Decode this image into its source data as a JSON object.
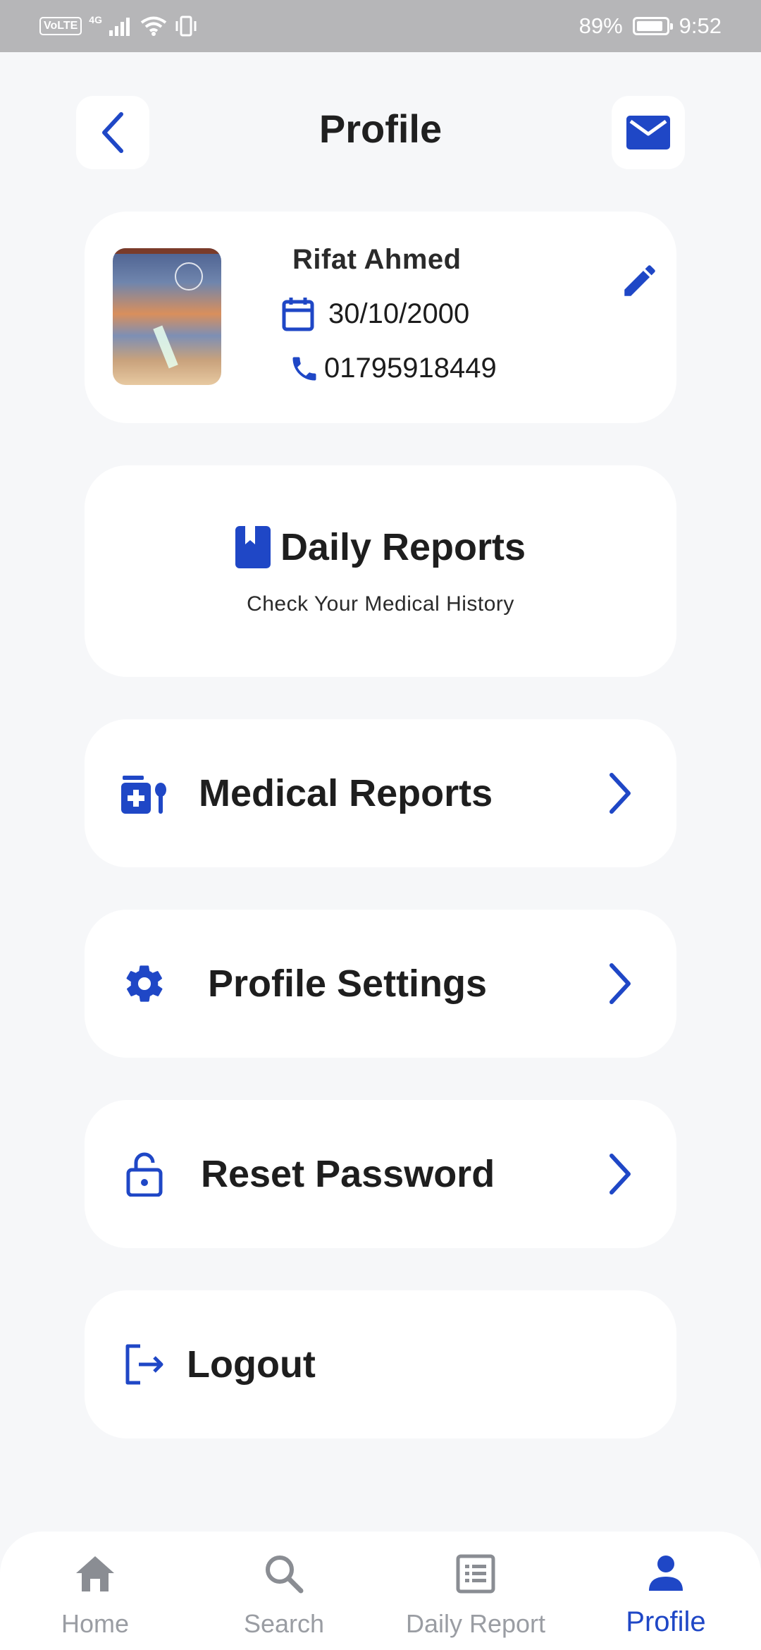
{
  "status_bar": {
    "volte": "VoLTE",
    "network": "4G",
    "battery": "89%",
    "time": "9:52"
  },
  "header": {
    "title": "Profile",
    "back_icon": "chevron-left-icon",
    "mail_icon": "mail-icon"
  },
  "profile": {
    "name": "Rifat Ahmed",
    "dob": "30/10/2000",
    "phone": "01795918449"
  },
  "daily_reports": {
    "title": "Daily Reports",
    "subtitle": "Check Your Medical History"
  },
  "menu": [
    {
      "label": "Medical Reports",
      "icon": "medical-kit-icon"
    },
    {
      "label": "Profile Settings",
      "icon": "gear-icon"
    },
    {
      "label": "Reset Password",
      "icon": "lock-icon"
    },
    {
      "label": "Logout",
      "icon": "logout-icon"
    }
  ],
  "bottom_nav": [
    {
      "label": "Home",
      "icon": "home-icon"
    },
    {
      "label": "Search",
      "icon": "search-icon"
    },
    {
      "label": "Daily Report",
      "icon": "list-icon"
    },
    {
      "label": "Profile",
      "icon": "person-icon",
      "active": true
    }
  ],
  "colors": {
    "accent": "#1f47c6",
    "inactive": "#9a9da3",
    "background": "#f6f7f9"
  }
}
